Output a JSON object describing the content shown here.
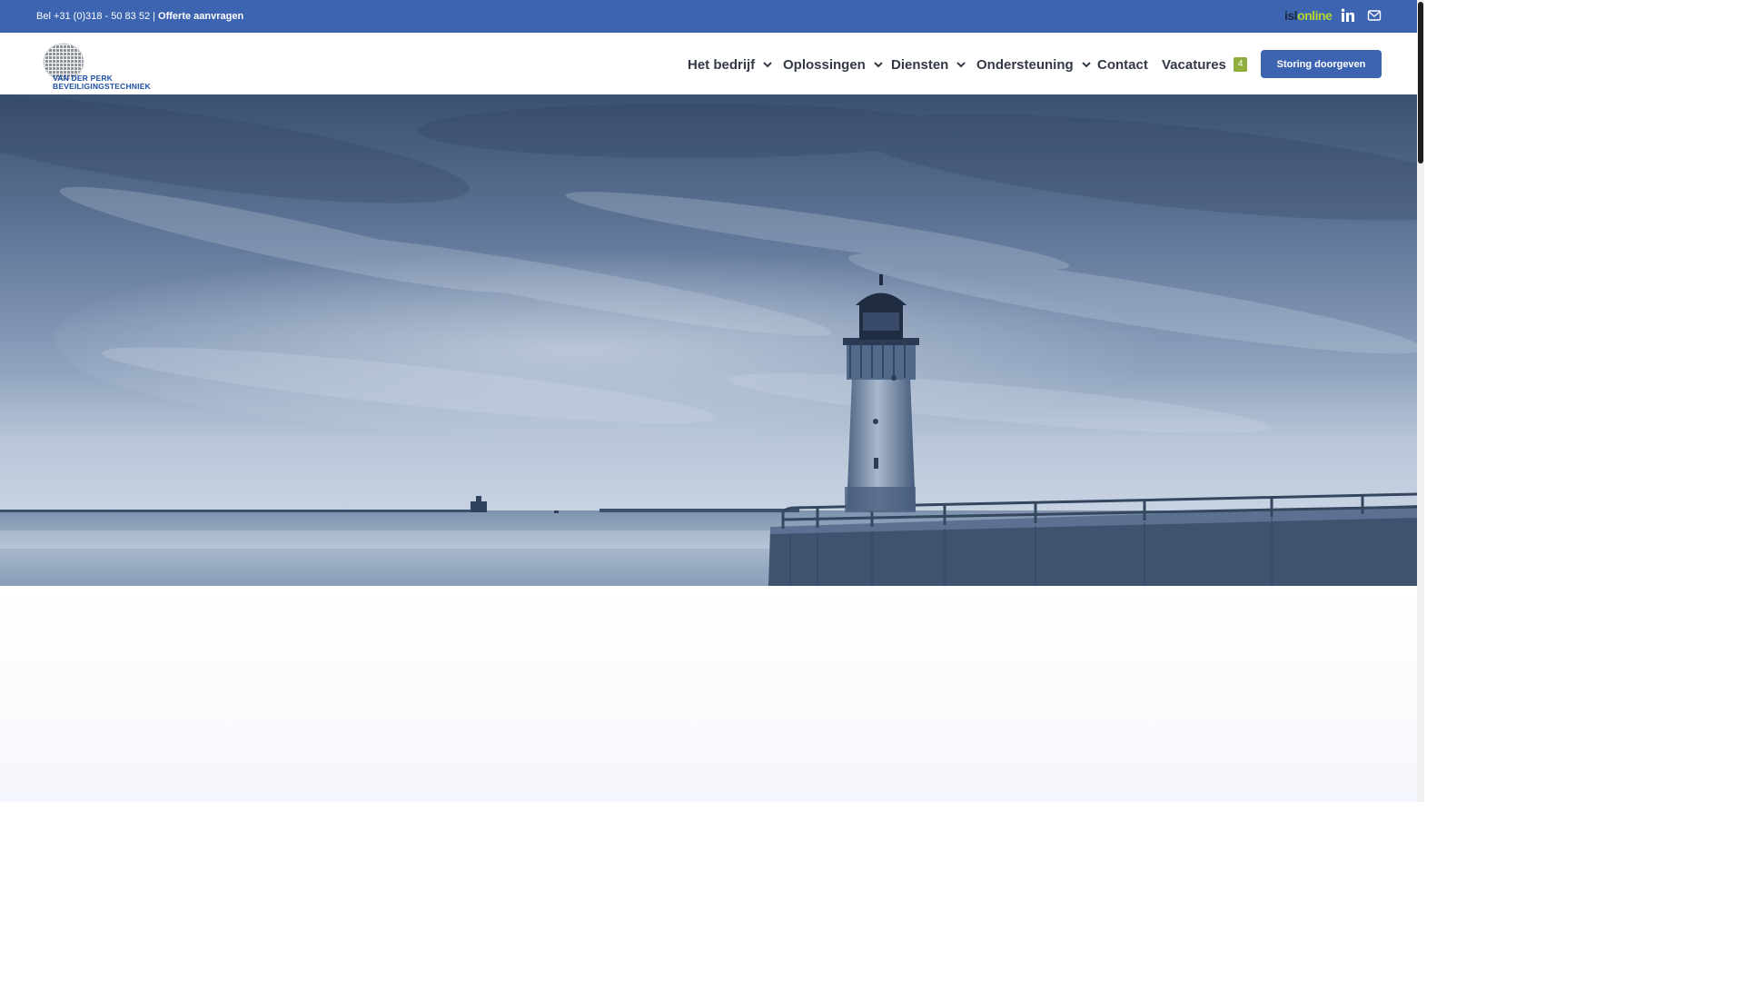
{
  "topbar": {
    "phone_text": "Bel +31 (0)318 - 50 83 52 |",
    "quote_link": "Offerte aanvragen",
    "isl_logo_part1": "isl",
    "isl_logo_part2": "online"
  },
  "logo": {
    "line1": "VAN DER PERK",
    "line2": "BEVEILIGINGSTECHNIEK"
  },
  "nav": {
    "items": [
      {
        "label": "Het bedrijf",
        "has_dropdown": true
      },
      {
        "label": "Oplossingen",
        "has_dropdown": true
      },
      {
        "label": "Diensten",
        "has_dropdown": true
      },
      {
        "label": "Ondersteuning",
        "has_dropdown": true
      },
      {
        "label": "Contact",
        "has_dropdown": false
      },
      {
        "label": "Vacatures",
        "has_dropdown": false,
        "badge": "4"
      }
    ],
    "cta": "Storing doorgeven"
  },
  "colors": {
    "brand_blue": "#3c64b1",
    "badge_green": "#8fae3d",
    "nav_text": "#333a46"
  },
  "icons": [
    "linkedin-icon",
    "mail-icon",
    "chevron-down-icon"
  ]
}
